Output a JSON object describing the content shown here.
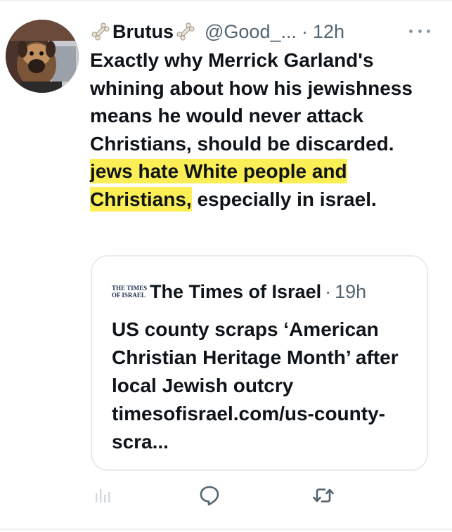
{
  "tweet": {
    "display_name": "Brutus",
    "name_emoji_icon": "bone-icon",
    "handle": "@Good_...",
    "separator": "·",
    "time": "12h",
    "more_icon": "more-horizontal-icon",
    "text_plain": "Exactly why Merrick Garland's whining about how his jewishness means he would never attack Christians, should be discarded. ",
    "text_highlighted": "jews hate White people and Christians,",
    "text_after": " especially in israel.",
    "highlight_color": "#fbef55"
  },
  "quote": {
    "logo_line1": "THE TIMES",
    "logo_line2": "OF ISRAEL",
    "source_name": "The Times of Israel",
    "separator": "·",
    "time": "19h",
    "text": "US county scraps ‘American Christian Heritage Month’ after local Jewish outcry timesofisrael.com/us-county-scra..."
  },
  "actions": {
    "analytics_icon": "analytics-icon",
    "reply_icon": "reply-icon",
    "retweet_icon": "retweet-icon"
  },
  "colors": {
    "primary_text": "#0f1419",
    "secondary_text": "#536471",
    "border": "#e6ecf0"
  }
}
